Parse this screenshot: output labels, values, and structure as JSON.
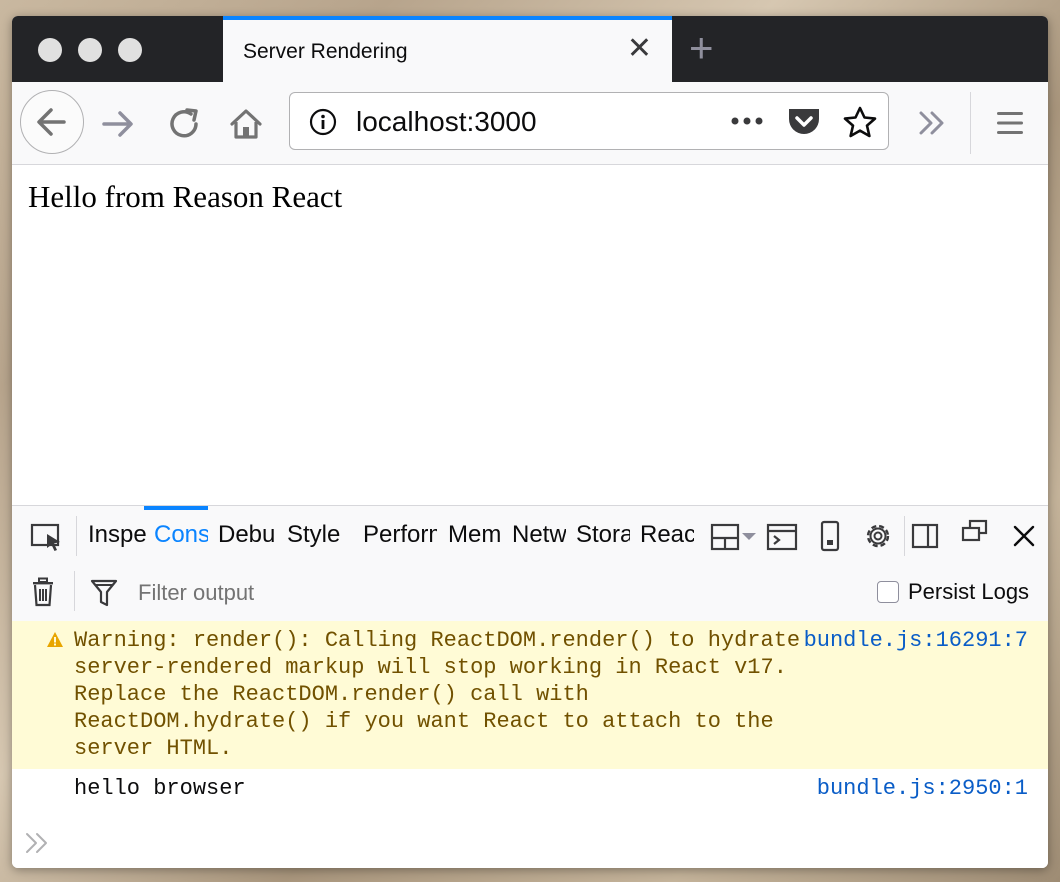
{
  "window": {
    "tab": {
      "title": "Server Rendering",
      "close_glyph": "✕"
    },
    "new_tab_glyph": "+"
  },
  "navbar": {
    "url": "localhost:3000",
    "icons": [
      "back-icon",
      "forward-icon",
      "reload-icon",
      "home-icon",
      "info-icon",
      "more-icon",
      "pocket-icon",
      "bookmark-star-icon",
      "overflow-icon",
      "hamburger-menu-icon"
    ]
  },
  "page": {
    "text": "Hello from Reason React"
  },
  "devtools": {
    "tabs": [
      {
        "label": "Inspector",
        "active": false
      },
      {
        "label": "Console",
        "active": true
      },
      {
        "label": "Debugger",
        "active": false
      },
      {
        "label": "Style Editor",
        "active": false
      },
      {
        "label": "Performance",
        "active": false
      },
      {
        "label": "Memory",
        "active": false
      },
      {
        "label": "Network",
        "active": false
      },
      {
        "label": "Storage",
        "active": false
      },
      {
        "label": "React",
        "active": false
      }
    ],
    "filter_placeholder": "Filter output",
    "persist_logs_label": "Persist Logs",
    "persist_logs_checked": false,
    "messages": [
      {
        "level": "warning",
        "lines": [
          "Warning: render(): Calling ReactDOM.render() to hydrate",
          "server-rendered markup will stop working in React v17.",
          "Replace the ReactDOM.render() call with",
          "ReactDOM.hydrate() if you want React to attach to the",
          "server HTML."
        ],
        "source": "bundle.js:16291:7"
      },
      {
        "level": "log",
        "lines": [
          "hello browser"
        ],
        "source": "bundle.js:2950:1"
      }
    ],
    "prompt_glyph": "»"
  },
  "colors": {
    "accent": "#0a84ff",
    "warning_bg": "#fffbd6",
    "warning_text": "#715100",
    "link": "#0a5dc7"
  }
}
